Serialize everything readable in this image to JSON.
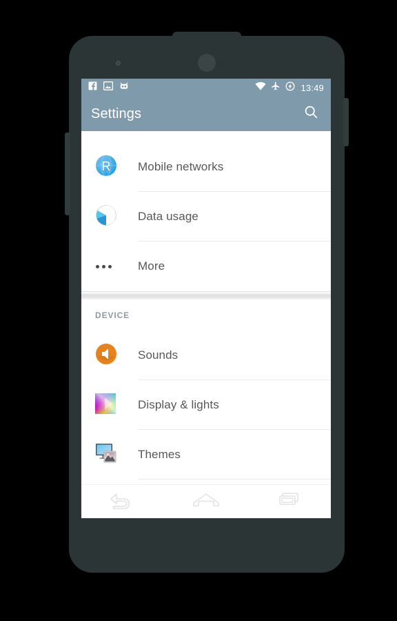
{
  "device": {
    "body_color": "#2b3536",
    "earpiece": "earpiece-speaker",
    "front_camera": "front-camera",
    "volume_rocker": "volume-rocker",
    "power_button": "power-button"
  },
  "status_bar": {
    "background": "#7f9aab",
    "time": "13:49",
    "left_icons": [
      {
        "name": "facebook-icon",
        "label": "Facebook"
      },
      {
        "name": "screenshot-image-icon",
        "label": "Screenshot"
      },
      {
        "name": "cyanogenmod-icon",
        "label": "CyanogenMod"
      }
    ],
    "right_icons": [
      {
        "name": "wifi-icon",
        "label": "Wi-Fi"
      },
      {
        "name": "airplane-mode-icon",
        "label": "Airplane mode"
      },
      {
        "name": "battery-charging-icon",
        "label": "Battery charging"
      }
    ]
  },
  "action_bar": {
    "title": "Settings",
    "search_icon": "search-icon",
    "background": "#7f9aab",
    "text_color": "#ffffff"
  },
  "list": {
    "items": [
      {
        "id": "mobile-networks",
        "label": "Mobile networks",
        "icon": "globe-roaming-icon"
      },
      {
        "id": "data-usage",
        "label": "Data usage",
        "icon": "pie-chart-icon"
      },
      {
        "id": "more",
        "label": "More",
        "icon": "more-dots-icon"
      }
    ]
  },
  "device_section": {
    "header": "DEVICE",
    "items": [
      {
        "id": "sounds",
        "label": "Sounds",
        "icon": "speaker-volume-icon",
        "icon_color": "#e8821e"
      },
      {
        "id": "display-and-lights",
        "label": "Display & lights",
        "icon": "color-gradient-icon"
      },
      {
        "id": "themes",
        "label": "Themes",
        "icon": "themes-monitor-picture-icon"
      }
    ]
  },
  "nav_bar": {
    "buttons": [
      {
        "id": "back",
        "name": "back-nav-icon",
        "label": "Back"
      },
      {
        "id": "home",
        "name": "home-nav-icon",
        "label": "Home"
      },
      {
        "id": "recents",
        "name": "recents-nav-icon",
        "label": "Recents"
      }
    ]
  },
  "colors": {
    "accent": "#7f9aab",
    "list_text": "#575757",
    "section_header_text": "#8e9aa0",
    "divider": "#e8e8e8"
  }
}
